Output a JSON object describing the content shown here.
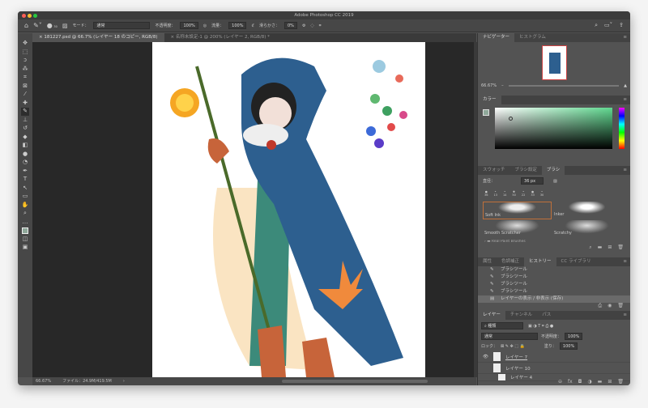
{
  "window": {
    "title": "Adobe Photoshop CC 2019"
  },
  "options": {
    "mode_label": "モード：",
    "mode": "通常",
    "opacity_label": "不透明度：",
    "opacity": "100%",
    "flow_label": "流量：",
    "flow": "100%",
    "smoothing_label": "滑らかさ：",
    "smoothing": "0%",
    "brush_size": "30"
  },
  "doc_tabs": [
    {
      "label": "181227.psd @ 66.7% (レイヤー 18 のコピー, RGB/8)"
    },
    {
      "label": "名称未設定-1 @ 200% (レイヤー 2, RGB/8) *"
    }
  ],
  "status": {
    "zoom": "66.67%",
    "file": "ファイル：24.9M/419.5M"
  },
  "navigator": {
    "tabs": [
      "ナビゲーター",
      "ヒストグラム"
    ],
    "zoom": "66.67%"
  },
  "color": {
    "tab": "カラー",
    "fg": "#8fa89a",
    "hue_accent": "#5fd88f"
  },
  "brush": {
    "tabs": [
      "スウォッチ",
      "ブラシ設定",
      "ブラシ"
    ],
    "size_label": "直径：",
    "size": "36 px",
    "presets": [
      "36",
      "13",
      "14",
      "50",
      "22",
      "33",
      "30"
    ],
    "brushes": [
      "Soft Ink",
      "Inker",
      "Smooth Scratcher",
      "Scratchy"
    ],
    "group": "Real Paint Brushes"
  },
  "history": {
    "tabs": [
      "属性",
      "色調補正",
      "ヒストリー",
      "CC ライブラリ"
    ],
    "items": [
      "ブラシツール",
      "ブラシツール",
      "ブラシツール",
      "ブラシツール",
      "レイヤーの表示 / 非表示 (保存)"
    ]
  },
  "layers": {
    "tabs": [
      "レイヤー",
      "チャンネル",
      "パス"
    ],
    "filter": "種類",
    "blend": "通常",
    "opacity_label": "不透明度：",
    "opacity": "100%",
    "lock_label": "ロック：",
    "fill_label": "塗り：",
    "fill": "100%",
    "items": [
      "レイヤー 7",
      "レイヤー 10",
      "レイヤー 4"
    ]
  }
}
